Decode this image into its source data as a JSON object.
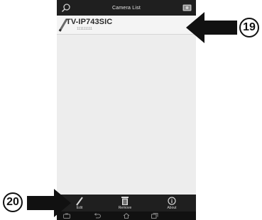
{
  "app": {
    "title": "Camera List"
  },
  "camera_list": [
    {
      "name": "TV-IP743SIC",
      "subtitle": "111111111"
    }
  ],
  "action_bar": {
    "items": [
      {
        "label": "Edit",
        "icon": "pencil-icon"
      },
      {
        "label": "Remove",
        "icon": "trash-icon"
      },
      {
        "label": "About",
        "icon": "info-icon"
      }
    ]
  },
  "nav_bar": {
    "items": [
      "camera-icon",
      "back-icon",
      "home-icon",
      "recent-apps-icon"
    ]
  },
  "callouts": {
    "top_number": "19",
    "bottom_number": "20"
  },
  "colors": {
    "bar": "#1f1f1f",
    "list_bg": "#ededed",
    "arrow": "#111111"
  }
}
